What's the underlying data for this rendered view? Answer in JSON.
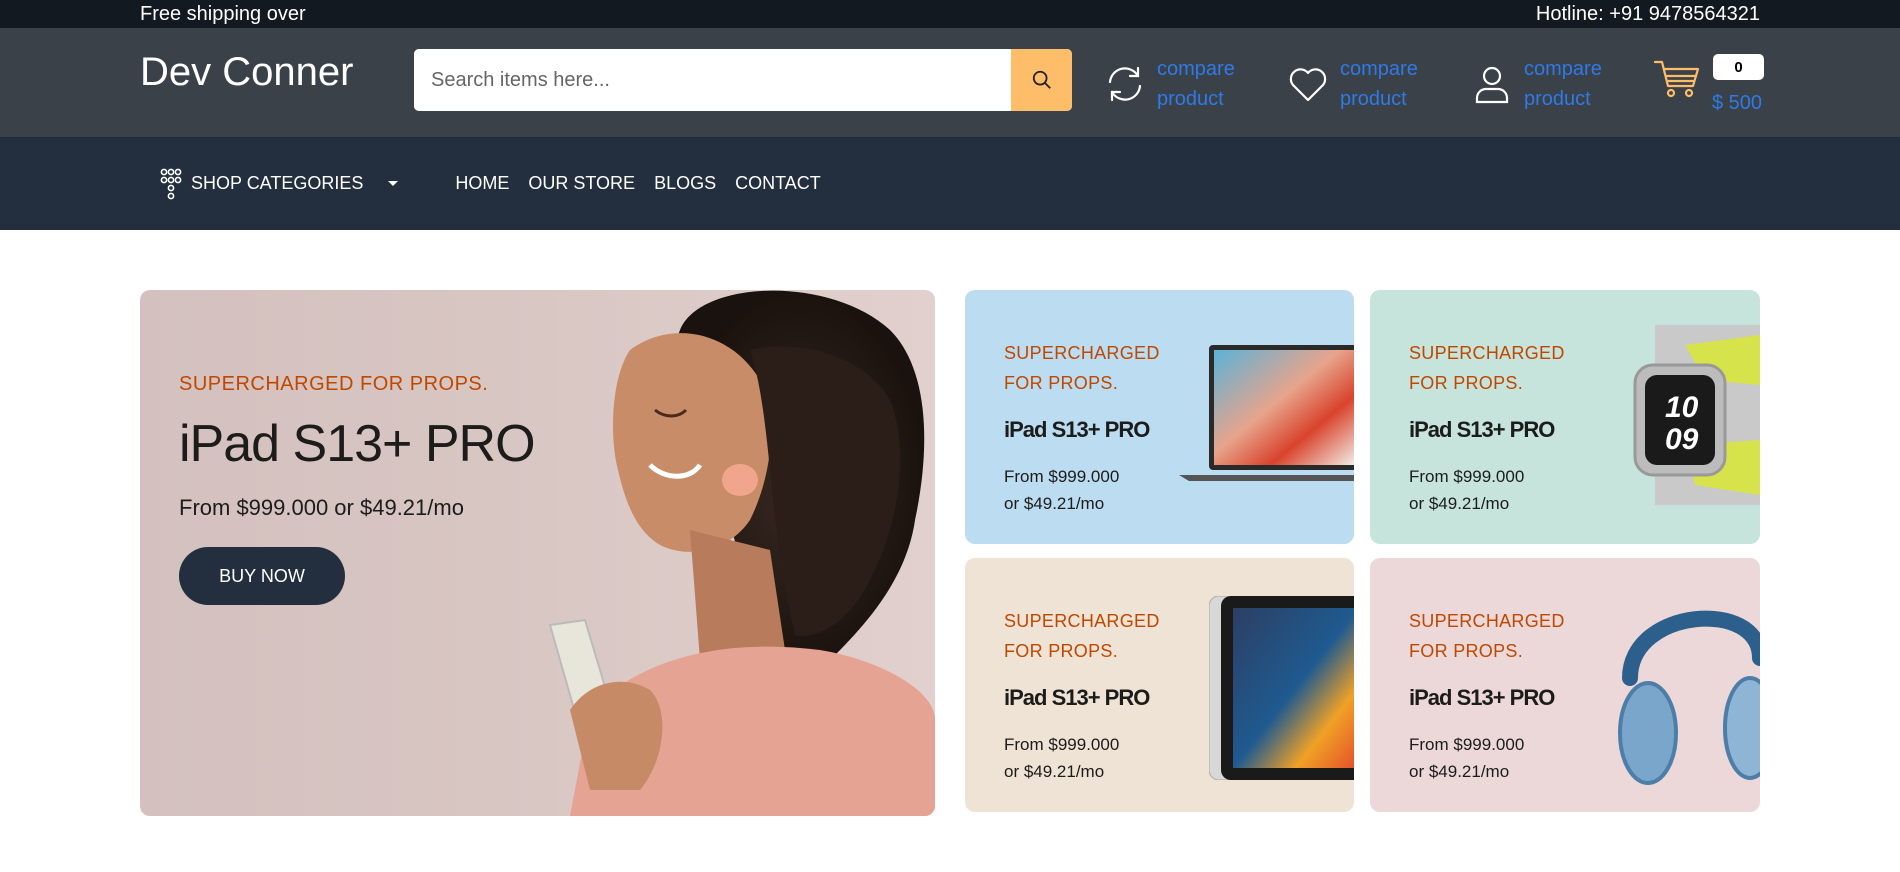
{
  "topbar": {
    "shipping_text": "Free shipping over",
    "hotline_text": "Hotline: +91 9478564321"
  },
  "header": {
    "logo": "Dev Conner",
    "search_placeholder": "Search items here...",
    "links": [
      {
        "line1": "compare",
        "line2": "product",
        "icon": "refresh-icon"
      },
      {
        "line1": "compare",
        "line2": "product",
        "icon": "heart-icon"
      },
      {
        "line1": "compare",
        "line2": "product",
        "icon": "user-icon"
      }
    ],
    "cart": {
      "count": "0",
      "total": "$ 500",
      "icon": "cart-icon"
    }
  },
  "nav": {
    "categories_label": "SHOP CATEGORIES",
    "links": [
      "HOME",
      "OUR STORE",
      "BLOGS",
      "CONTACT"
    ]
  },
  "main_banner": {
    "subtitle": "SUPERCHARGED FOR PROPS.",
    "title": "iPad S13+ PRO",
    "price": "From $999.000 or $49.21/mo",
    "button": "BUY NOW"
  },
  "small_banners": [
    {
      "subtitle": "SUPERCHARGED FOR PROPS.",
      "title": "iPad S13+ PRO",
      "price_line1": "From $999.000",
      "price_line2": "or $49.21/mo",
      "image": "laptop"
    },
    {
      "subtitle": "SUPERCHARGED FOR PROPS.",
      "title": "iPad S13+ PRO",
      "price_line1": "From $999.000",
      "price_line2": "or $49.21/mo",
      "image": "smartwatch"
    },
    {
      "subtitle": "SUPERCHARGED FOR PROPS.",
      "title": "iPad S13+ PRO",
      "price_line1": "From $999.000",
      "price_line2": "or $49.21/mo",
      "image": "tablet"
    },
    {
      "subtitle": "SUPERCHARGED FOR PROPS.",
      "title": "iPad S13+ PRO",
      "price_line1": "From $999.000",
      "price_line2": "or $49.21/mo",
      "image": "headphones"
    }
  ],
  "colors": {
    "topbar": "#131921",
    "header": "#3b4149",
    "nav": "#232f3e",
    "accent": "#febd69",
    "link": "#2f7ae5",
    "subtitle": "#bf4800"
  }
}
